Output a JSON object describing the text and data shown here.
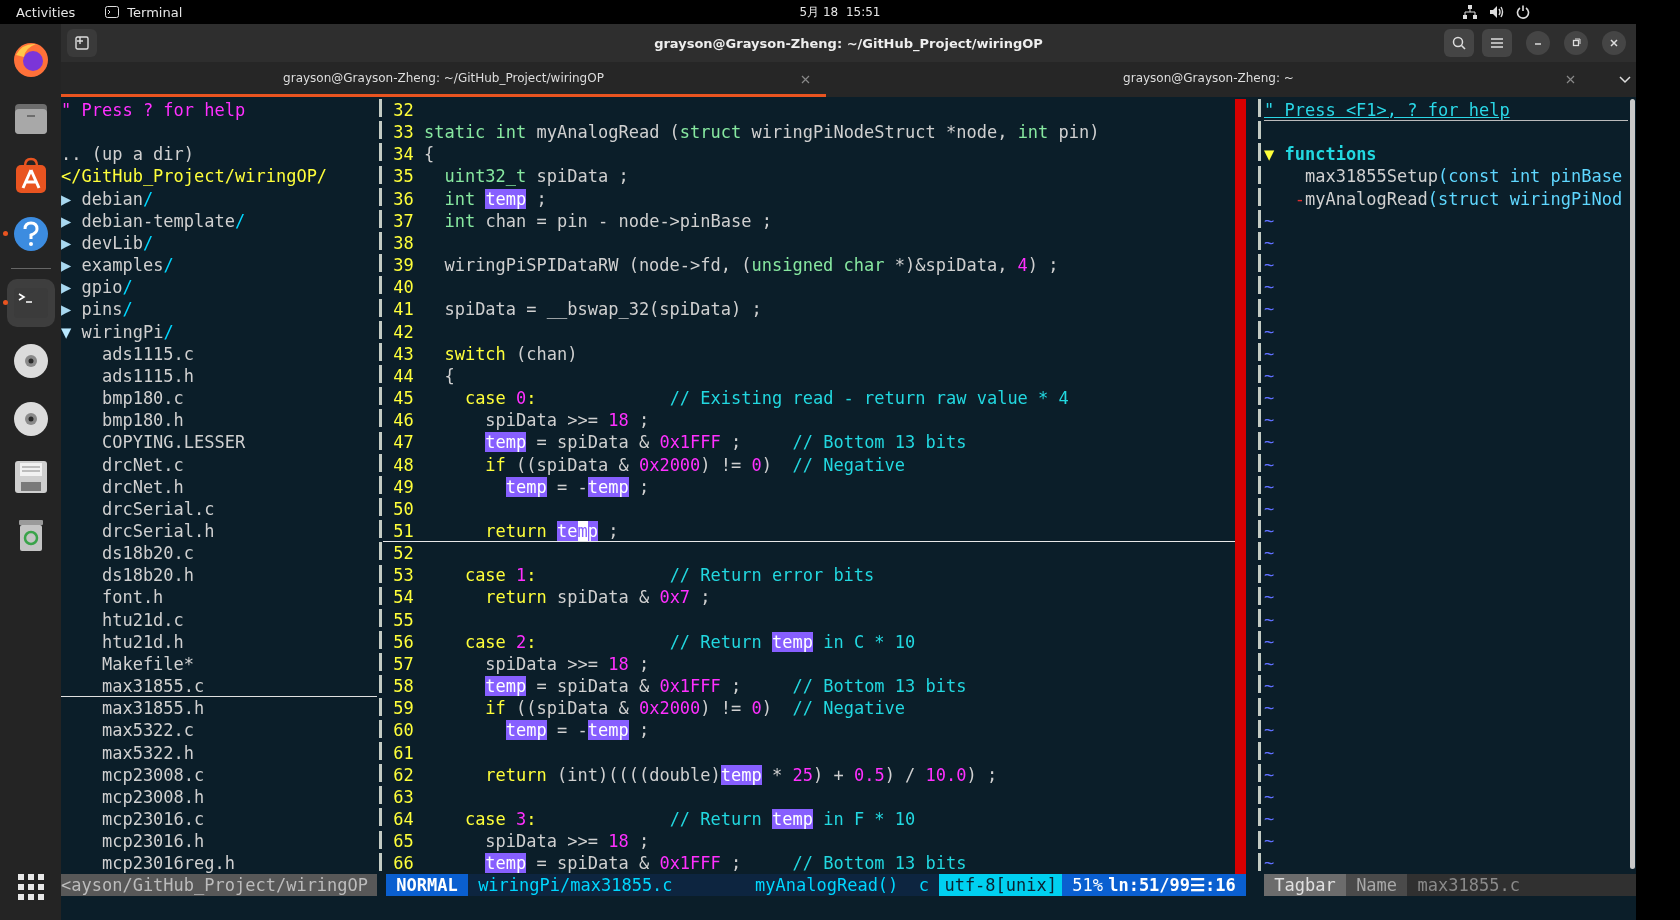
{
  "top_bar": {
    "activities": "Activities",
    "app_name": "Terminal",
    "clock": "5月 18  15:51"
  },
  "dock": [
    {
      "kind": "browser",
      "running": false,
      "active": false
    },
    {
      "kind": "files",
      "running": false,
      "active": false
    },
    {
      "kind": "store",
      "running": false,
      "active": false
    },
    {
      "kind": "help",
      "running": true,
      "active": false
    },
    {
      "kind": "separator"
    },
    {
      "kind": "terminal",
      "running": true,
      "active": true
    },
    {
      "kind": "disc",
      "running": false,
      "active": false
    },
    {
      "kind": "disc",
      "running": false,
      "active": false
    },
    {
      "kind": "floppy",
      "running": false,
      "active": false
    },
    {
      "kind": "trash",
      "running": false,
      "active": false
    }
  ],
  "window": {
    "title": "grayson@Grayson-Zheng: ~/GitHub_Project/wiringOP"
  },
  "tabs": [
    {
      "title": "grayson@Grayson-Zheng: ~/GitHub_Project/wiringOP",
      "selected": true
    },
    {
      "title": "grayson@Grayson-Zheng: ~",
      "selected": false
    }
  ],
  "file_tree": {
    "help": "\" Press ? for help",
    "up_dir": ".. (up a dir)",
    "root": "</GitHub_Project/wiringOP/",
    "items": [
      {
        "arrow": "▶",
        "name": "debian",
        "suffix": "/",
        "expanded": false,
        "selected": false
      },
      {
        "arrow": "▶",
        "name": "debian-template",
        "suffix": "/",
        "expanded": false,
        "selected": false
      },
      {
        "arrow": "▶",
        "name": "devLib",
        "suffix": "/",
        "expanded": false,
        "selected": false
      },
      {
        "arrow": "▶",
        "name": "examples",
        "suffix": "/",
        "expanded": false,
        "selected": false
      },
      {
        "arrow": "▶",
        "name": "gpio",
        "suffix": "/",
        "expanded": false,
        "selected": false
      },
      {
        "arrow": "▶",
        "name": "pins",
        "suffix": "/",
        "expanded": false,
        "selected": false
      },
      {
        "arrow": "▼",
        "name": "wiringPi",
        "suffix": "/",
        "expanded": true,
        "selected": false,
        "children": [
          {
            "name": "ads1115.c",
            "selected": false
          },
          {
            "name": "ads1115.h",
            "selected": false
          },
          {
            "name": "bmp180.c",
            "selected": false
          },
          {
            "name": "bmp180.h",
            "selected": false
          },
          {
            "name": "COPYING.LESSER",
            "selected": false
          },
          {
            "name": "drcNet.c",
            "selected": false
          },
          {
            "name": "drcNet.h",
            "selected": false
          },
          {
            "name": "drcSerial.c",
            "selected": false
          },
          {
            "name": "drcSerial.h",
            "selected": false
          },
          {
            "name": "ds18b20.c",
            "selected": false
          },
          {
            "name": "ds18b20.h",
            "selected": false
          },
          {
            "name": "font.h",
            "selected": false
          },
          {
            "name": "htu21d.c",
            "selected": false
          },
          {
            "name": "htu21d.h",
            "selected": false
          },
          {
            "name": "Makefile*",
            "selected": false
          },
          {
            "name": "max31855.c",
            "selected": true
          },
          {
            "name": "max31855.h",
            "selected": false
          },
          {
            "name": "max5322.c",
            "selected": false
          },
          {
            "name": "max5322.h",
            "selected": false
          },
          {
            "name": "mcp23008.c",
            "selected": false
          },
          {
            "name": "mcp23008.h",
            "selected": false
          },
          {
            "name": "mcp23016.c",
            "selected": false
          },
          {
            "name": "mcp23016.h",
            "selected": false
          },
          {
            "name": "mcp23016reg.h",
            "selected": false
          }
        ]
      }
    ]
  },
  "editor": {
    "lines": [
      {
        "number": "32",
        "current": false
      },
      {
        "number": "33",
        "current": false,
        "segments": [
          {
            "text": "static int",
            "kind": "type"
          },
          {
            "text": " myAnalogRead (",
            "kind": "plain"
          },
          {
            "text": "struct",
            "kind": "type"
          },
          {
            "text": " wiringPiNodeStruct *node, ",
            "kind": "plain"
          },
          {
            "text": "int",
            "kind": "type"
          },
          {
            "text": " pin)",
            "kind": "plain"
          }
        ]
      },
      {
        "number": "34",
        "current": false,
        "segments": [
          {
            "text": "{",
            "kind": "plain"
          }
        ]
      },
      {
        "number": "35",
        "current": false,
        "segments": [
          {
            "text": "  uint32_t",
            "kind": "type"
          },
          {
            "text": " spiData ;",
            "kind": "plain"
          }
        ]
      },
      {
        "number": "36",
        "current": false,
        "segments": [
          {
            "text": "  int ",
            "kind": "type"
          },
          {
            "text": "temp",
            "kind": "match"
          },
          {
            "text": " ;",
            "kind": "plain"
          }
        ]
      },
      {
        "number": "37",
        "current": false,
        "segments": [
          {
            "text": "  int",
            "kind": "type"
          },
          {
            "text": " chan = pin - node->pinBase ;",
            "kind": "plain"
          }
        ]
      },
      {
        "number": "38",
        "current": false
      },
      {
        "number": "39",
        "current": false,
        "segments": [
          {
            "text": "  wiringPiSPIDataRW (node->fd, (",
            "kind": "plain"
          },
          {
            "text": "unsigned char",
            "kind": "type"
          },
          {
            "text": " *)&spiData, ",
            "kind": "plain"
          },
          {
            "text": "4",
            "kind": "number"
          },
          {
            "text": ") ;",
            "kind": "plain"
          }
        ]
      },
      {
        "number": "40",
        "current": false
      },
      {
        "number": "41",
        "current": false,
        "segments": [
          {
            "text": "  spiData = __bswap_32(spiData) ;",
            "kind": "plain"
          }
        ]
      },
      {
        "number": "42",
        "current": false
      },
      {
        "number": "43",
        "current": false,
        "segments": [
          {
            "text": "  switch",
            "kind": "keyword"
          },
          {
            "text": " (chan)",
            "kind": "plain"
          }
        ]
      },
      {
        "number": "44",
        "current": false,
        "segments": [
          {
            "text": "  {",
            "kind": "plain"
          }
        ]
      },
      {
        "number": "45",
        "current": false,
        "segments": [
          {
            "text": "    case ",
            "kind": "keyword"
          },
          {
            "text": "0",
            "kind": "number"
          },
          {
            "text": ":             ",
            "kind": "keyword"
          },
          {
            "text": "// Existing read - return raw value * 4",
            "kind": "comment"
          }
        ]
      },
      {
        "number": "46",
        "current": false,
        "segments": [
          {
            "text": "      spiData >>= ",
            "kind": "plain"
          },
          {
            "text": "18",
            "kind": "number"
          },
          {
            "text": " ;",
            "kind": "plain"
          }
        ]
      },
      {
        "number": "47",
        "current": false,
        "segments": [
          {
            "text": "      temp",
            "kind": "match"
          },
          {
            "text": " = spiData & ",
            "kind": "plain"
          },
          {
            "text": "0x1FFF",
            "kind": "number"
          },
          {
            "text": " ;     ",
            "kind": "plain"
          },
          {
            "text": "// Bottom 13 bits",
            "kind": "comment"
          }
        ]
      },
      {
        "number": "48",
        "current": false,
        "segments": [
          {
            "text": "      if",
            "kind": "keyword"
          },
          {
            "text": " ((spiData & ",
            "kind": "plain"
          },
          {
            "text": "0x2000",
            "kind": "number"
          },
          {
            "text": ") != ",
            "kind": "plain"
          },
          {
            "text": "0",
            "kind": "number"
          },
          {
            "text": ")  ",
            "kind": "plain"
          },
          {
            "text": "// Negative",
            "kind": "comment"
          }
        ]
      },
      {
        "number": "49",
        "current": false,
        "segments": [
          {
            "text": "        temp",
            "kind": "match"
          },
          {
            "text": " = -",
            "kind": "plain"
          },
          {
            "text": "temp",
            "kind": "match"
          },
          {
            "text": " ;",
            "kind": "plain"
          }
        ]
      },
      {
        "number": "50",
        "current": false
      },
      {
        "number": "51",
        "current": true,
        "segments": [
          {
            "text": "      return ",
            "kind": "keyword"
          },
          {
            "text": "te",
            "kind": "match"
          },
          {
            "text": "m",
            "kind": "cursor"
          },
          {
            "text": "p",
            "kind": "match"
          },
          {
            "text": " ;",
            "kind": "plain"
          }
        ]
      },
      {
        "number": "52",
        "current": false
      },
      {
        "number": "53",
        "current": false,
        "segments": [
          {
            "text": "    case ",
            "kind": "keyword"
          },
          {
            "text": "1",
            "kind": "number"
          },
          {
            "text": ":             ",
            "kind": "keyword"
          },
          {
            "text": "// Return error bits",
            "kind": "comment"
          }
        ]
      },
      {
        "number": "54",
        "current": false,
        "segments": [
          {
            "text": "      return",
            "kind": "keyword"
          },
          {
            "text": " spiData & ",
            "kind": "plain"
          },
          {
            "text": "0x7",
            "kind": "number"
          },
          {
            "text": " ;",
            "kind": "plain"
          }
        ]
      },
      {
        "number": "55",
        "current": false
      },
      {
        "number": "56",
        "current": false,
        "segments": [
          {
            "text": "    case ",
            "kind": "keyword"
          },
          {
            "text": "2",
            "kind": "number"
          },
          {
            "text": ":             ",
            "kind": "keyword"
          },
          {
            "text": "// Return ",
            "kind": "comment"
          },
          {
            "text": "temp",
            "kind": "match"
          },
          {
            "text": " in C * 10",
            "kind": "comment"
          }
        ]
      },
      {
        "number": "57",
        "current": false,
        "segments": [
          {
            "text": "      spiData >>= ",
            "kind": "plain"
          },
          {
            "text": "18",
            "kind": "number"
          },
          {
            "text": " ;",
            "kind": "plain"
          }
        ]
      },
      {
        "number": "58",
        "current": false,
        "segments": [
          {
            "text": "      temp",
            "kind": "match"
          },
          {
            "text": " = spiData & ",
            "kind": "plain"
          },
          {
            "text": "0x1FFF",
            "kind": "number"
          },
          {
            "text": " ;     ",
            "kind": "plain"
          },
          {
            "text": "// Bottom 13 bits",
            "kind": "comment"
          }
        ]
      },
      {
        "number": "59",
        "current": false,
        "segments": [
          {
            "text": "      if",
            "kind": "keyword"
          },
          {
            "text": " ((spiData & ",
            "kind": "plain"
          },
          {
            "text": "0x2000",
            "kind": "number"
          },
          {
            "text": ") != ",
            "kind": "plain"
          },
          {
            "text": "0",
            "kind": "number"
          },
          {
            "text": ")  ",
            "kind": "plain"
          },
          {
            "text": "// Negative",
            "kind": "comment"
          }
        ]
      },
      {
        "number": "60",
        "current": false,
        "segments": [
          {
            "text": "        temp",
            "kind": "match"
          },
          {
            "text": " = -",
            "kind": "plain"
          },
          {
            "text": "temp",
            "kind": "match"
          },
          {
            "text": " ;",
            "kind": "plain"
          }
        ]
      },
      {
        "number": "61",
        "current": false
      },
      {
        "number": "62",
        "current": false,
        "segments": [
          {
            "text": "      return",
            "kind": "keyword"
          },
          {
            "text": " (int)((((double)",
            "kind": "plain"
          },
          {
            "text": "temp",
            "kind": "match"
          },
          {
            "text": " * ",
            "kind": "plain"
          },
          {
            "text": "25",
            "kind": "number"
          },
          {
            "text": ") + ",
            "kind": "plain"
          },
          {
            "text": "0.5",
            "kind": "number"
          },
          {
            "text": ") / ",
            "kind": "plain"
          },
          {
            "text": "10.0",
            "kind": "number"
          },
          {
            "text": ") ;",
            "kind": "plain"
          }
        ]
      },
      {
        "number": "63",
        "current": false
      },
      {
        "number": "64",
        "current": false,
        "segments": [
          {
            "text": "    case ",
            "kind": "keyword"
          },
          {
            "text": "3",
            "kind": "number"
          },
          {
            "text": ":             ",
            "kind": "keyword"
          },
          {
            "text": "// Return ",
            "kind": "comment"
          },
          {
            "text": "temp",
            "kind": "match"
          },
          {
            "text": " in F * 10",
            "kind": "comment"
          }
        ]
      },
      {
        "number": "65",
        "current": false,
        "segments": [
          {
            "text": "      spiData >>= ",
            "kind": "plain"
          },
          {
            "text": "18",
            "kind": "number"
          },
          {
            "text": " ;",
            "kind": "plain"
          }
        ]
      },
      {
        "number": "66",
        "current": false,
        "segments": [
          {
            "text": "      temp",
            "kind": "match"
          },
          {
            "text": " = spiData & ",
            "kind": "plain"
          },
          {
            "text": "0x1FFF",
            "kind": "number"
          },
          {
            "text": " ;     ",
            "kind": "plain"
          },
          {
            "text": "// Bottom 13 bits",
            "kind": "comment"
          }
        ]
      }
    ]
  },
  "tagbar": {
    "help": "\" Press <F1>, ? for help",
    "groups": [
      {
        "arrow": "▼",
        "name": "functions",
        "expanded": true,
        "children": [
          {
            "name": "max31855Setup",
            "signature": "(const int pinBase"
          },
          {
            "marker": "-",
            "name": "myAnalogRead",
            "signature": "(struct wiringPiNod"
          }
        ]
      }
    ],
    "filler": [
      "~",
      "~",
      "~",
      "~",
      "~",
      "~",
      "~",
      "~",
      "~",
      "~",
      "~",
      "~",
      "~",
      "~",
      "~",
      "~",
      "~",
      "~",
      "~",
      "~",
      "~",
      "~",
      "~",
      "~",
      "~",
      "~",
      "~",
      "~",
      "~",
      "~"
    ]
  },
  "status_line": {
    "tree_path": "<ayson/GitHub_Project/wiringOP",
    "mode": "NORMAL",
    "file": "wiringPi/max31855.c",
    "function": "myAnalogRead()",
    "filetype": "c",
    "encoding": "utf-8[unix]",
    "percent": "51%",
    "position": "ln:51/99☰:16",
    "tagbar_title": "Tagbar",
    "tagbar_sort": "Name",
    "tagbar_file": "max31855.c"
  }
}
